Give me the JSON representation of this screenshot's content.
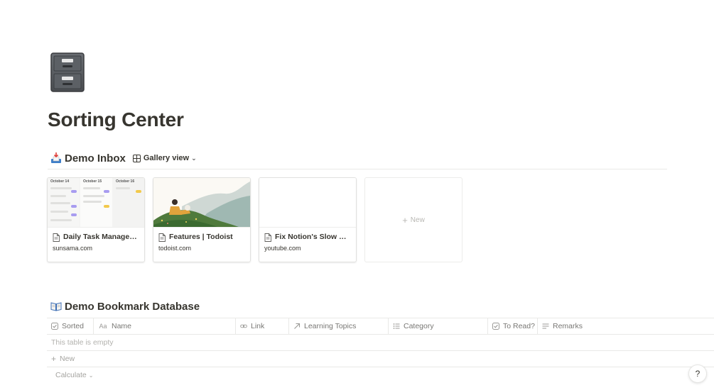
{
  "page": {
    "icon": "file-cabinet-icon",
    "title": "Sorting Center"
  },
  "inbox": {
    "icon": "inbox-tray-icon",
    "title": "Demo Inbox",
    "view_label": "Gallery view",
    "cards": [
      {
        "title": "Daily Task Manager &...",
        "url": "sunsama.com",
        "cover": "sunsama-calendar-cover",
        "days": [
          "October 14",
          "October 15",
          "October 16"
        ]
      },
      {
        "title": "Features | Todoist",
        "url": "todoist.com",
        "cover": "todoist-illustration-cover"
      },
      {
        "title": "Fix Notion's Slow Sea...",
        "url": "youtube.com",
        "cover": "blank-cover"
      }
    ],
    "new_label": "New"
  },
  "bookmarks": {
    "icon": "open-book-icon",
    "title": "Demo Bookmark Database",
    "columns": [
      {
        "label": "Sorted",
        "icon": "checkbox-icon"
      },
      {
        "label": "Name",
        "icon": "text-icon"
      },
      {
        "label": "Link",
        "icon": "link-icon"
      },
      {
        "label": "Learning Topics",
        "icon": "relation-arrow-icon"
      },
      {
        "label": "Category",
        "icon": "list-icon"
      },
      {
        "label": "To Read?",
        "icon": "checkbox-icon"
      },
      {
        "label": "Remarks",
        "icon": "paragraph-icon"
      }
    ],
    "empty_text": "This table is empty",
    "new_label": "New",
    "calculate_label": "Calculate"
  },
  "help": {
    "label": "?"
  },
  "colors": {
    "text": "#37352f",
    "muted": "#787774",
    "border": "#e9e9e7",
    "pill_purple": "#a89cf0",
    "pill_yellow": "#f2c94c"
  }
}
